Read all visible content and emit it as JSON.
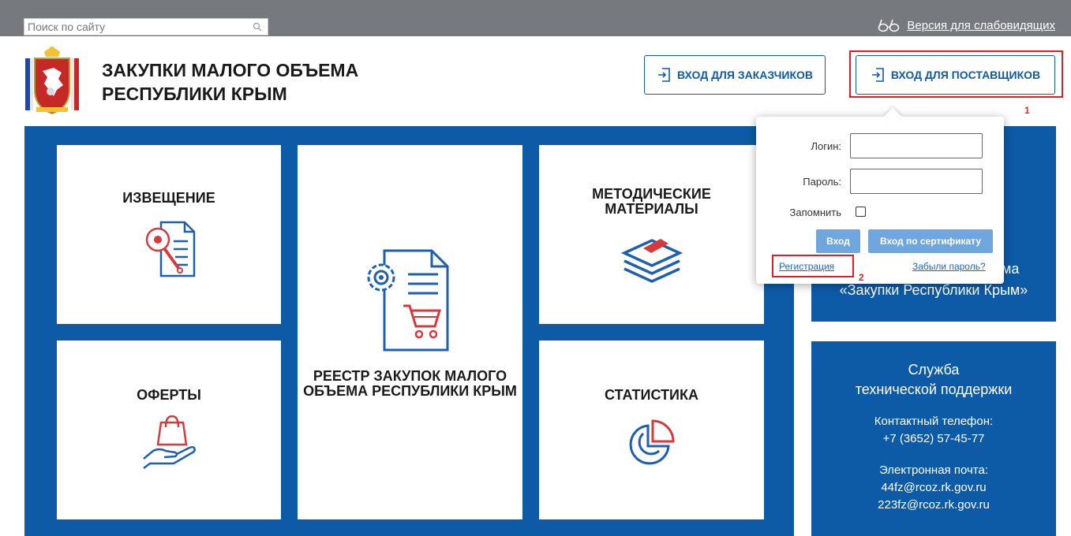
{
  "header": {
    "search_placeholder": "Поиск по сайту",
    "accessibility_link": "Версия для слабовидящих",
    "site_title_line1": "ЗАКУПКИ МАЛОГО ОБЪЕМА",
    "site_title_line2": "РЕСПУБЛИКИ КРЫМ",
    "login_customers": "ВХОД ДЛЯ ЗАКАЗЧИКОВ",
    "login_suppliers": "ВХОД ДЛЯ ПОСТАВЩИКОВ"
  },
  "annotations": {
    "marker1": "1",
    "marker2": "2"
  },
  "tiles": {
    "notice": "ИЗВЕЩЕНИЕ",
    "registry": "РЕЕСТР ЗАКУПОК МАЛОГО ОБЪЕМА РЕСПУБЛИКИ КРЫМ",
    "methodical_line1": "МЕТОДИЧЕСКИЕ",
    "methodical_line2": "МАТЕРИАЛЫ",
    "offers": "ОФЕРТЫ",
    "statistics": "СТАТИСТИКА"
  },
  "login_popup": {
    "login_label": "Логин:",
    "password_label": "Пароль:",
    "remember_label": "Запомнить",
    "submit_label": "Вход",
    "cert_label": "Вход по сертификату",
    "register_link": "Регистрация",
    "forgot_link": "Забыли пароль?"
  },
  "side_panel": {
    "partial_word": "ема",
    "system_name": "«Закупки Республики Крым»"
  },
  "support": {
    "title_line1": "Служба",
    "title_line2": "технической поддержки",
    "phone_label": "Контактный телефон:",
    "phone": "+7 (3652) 57-45-77",
    "email_label": "Электронная почта:",
    "email1": "44fz@rcoz.rk.gov.ru",
    "email2": "223fz@rcoz.rk.gov.ru"
  },
  "colors": {
    "topbar": "#76797e",
    "primary_blue": "#0d5ba6",
    "button_light_blue": "#6fa6de",
    "annotation_red": "#e01e24"
  }
}
